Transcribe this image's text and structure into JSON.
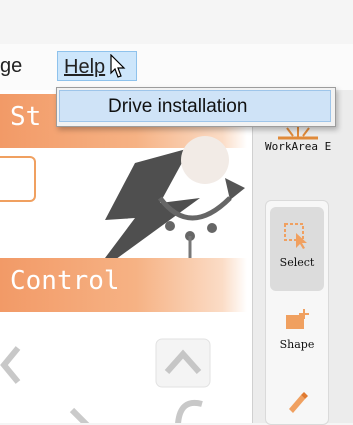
{
  "menubar": {
    "partial_menu_label": "ge",
    "help_label": "Help"
  },
  "help_menu": {
    "items": [
      {
        "label": "Drive installation"
      }
    ]
  },
  "left_panel": {
    "status_bar_title": "St",
    "control_bar_title": "Control"
  },
  "right_panel": {
    "workarea_label": "WorkArea E",
    "tools": [
      {
        "label": "Select",
        "icon": "select-cursor-icon"
      },
      {
        "label": "Shape",
        "icon": "shape-icon"
      },
      {
        "label": "",
        "icon": "pen-icon"
      }
    ]
  },
  "colors": {
    "accent_orange": "#f29a67",
    "menu_highlight": "#cde6fb"
  }
}
